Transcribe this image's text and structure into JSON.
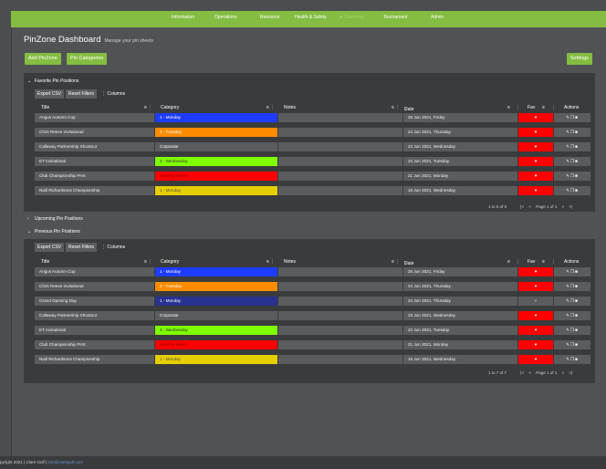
{
  "nav": {
    "items": [
      {
        "label": "Information",
        "icon": "",
        "dim": false
      },
      {
        "label": "Operations",
        "icon": "",
        "dim": false
      },
      {
        "label": "Resource",
        "icon": "",
        "dim": false
      },
      {
        "label": "Health & Safety",
        "icon": "",
        "dim": false
      },
      {
        "label": "Coaching",
        "icon": "lock-icon",
        "dim": true
      },
      {
        "label": "Tournament",
        "icon": "",
        "dim": false
      },
      {
        "label": "Admin",
        "icon": "",
        "dim": false
      }
    ]
  },
  "page": {
    "title": "PinZone Dashboard",
    "subtitle": "Manage your pin sheets"
  },
  "buttons": {
    "add": "Add PinZone",
    "categories": "Pin Categories",
    "settings": "Settings"
  },
  "sections": {
    "favorite": "Favorite Pin Positions",
    "upcoming": "Upcoming Pin Positions",
    "previous": "Previous Pin Positions"
  },
  "toolbar": {
    "export": "Export CSV",
    "reset": "Reset Filters",
    "columns": "Columns"
  },
  "columns": {
    "title": "Title",
    "category": "Category",
    "notes": "Notes",
    "date": "Date",
    "fav": "Fav",
    "actions": "Actions"
  },
  "colors": {
    "accent": "#84bd42",
    "fav": "#ff0000"
  },
  "favorite_rows": [
    {
      "title": "Angus Autumn Cup",
      "category": "1 - Monday",
      "cat_color": "#1e3cff",
      "cat_text": "#ffffff",
      "date": "25 Jun 2021, Friday",
      "fav": true
    },
    {
      "title": "Chris Reeve Invitational",
      "category": "2 - Tuesday",
      "cat_color": "#ff8c00",
      "cat_text": "#ffffff",
      "date": "24 Jun 2021, Thursday",
      "fav": true
    },
    {
      "title": "Callaway Partnership Shootout",
      "category": "Corporate",
      "cat_color": "#5a5c5e",
      "cat_text": "#ffffff",
      "date": "23 Jun 2021, Wednesday",
      "fav": true
    },
    {
      "title": "ET Invitational",
      "category": "3 - Wednesday",
      "cat_color": "#7fff00",
      "cat_text": "#333333",
      "date": "22 Jun 2021, Tuesday",
      "fav": true
    },
    {
      "title": "Club Championship PHX",
      "category": "Monthly Medal",
      "cat_color": "#ff0000",
      "cat_text": "#8b0000",
      "date": "21 Jun 2021, Monday",
      "fav": true
    },
    {
      "title": "Niall Richardsons Championship",
      "category": "1 - Monday",
      "cat_color": "#e6cf00",
      "cat_text": "#555555",
      "date": "16 Jun 2021, Wednesday",
      "fav": true
    }
  ],
  "previous_rows": [
    {
      "title": "Angus Autumn Cup",
      "category": "1 - Monday",
      "cat_color": "#1e3cff",
      "cat_text": "#ffffff",
      "date": "25 Jun 2021, Friday",
      "fav": true
    },
    {
      "title": "Chris Reeve Invitational",
      "category": "2 - Tuesday",
      "cat_color": "#ff8c00",
      "cat_text": "#ffffff",
      "date": "24 Jun 2021, Thursday",
      "fav": true
    },
    {
      "title": "Grand Opening Day",
      "category": "1 - Monday",
      "cat_color": "#283290",
      "cat_text": "#ffffff",
      "date": "24 Jun 2021, Thursday",
      "fav": false
    },
    {
      "title": "Callaway Partnership Shootout",
      "category": "Corporate",
      "cat_color": "#5a5c5e",
      "cat_text": "#ffffff",
      "date": "23 Jun 2021, Wednesday",
      "fav": true
    },
    {
      "title": "ET Invitational",
      "category": "3 - Wednesday",
      "cat_color": "#7fff00",
      "cat_text": "#333333",
      "date": "22 Jun 2021, Tuesday",
      "fav": true
    },
    {
      "title": "Club Championship PHX",
      "category": "Monthly Medal",
      "cat_color": "#ff0000",
      "cat_text": "#8b0000",
      "date": "21 Jun 2021, Monday",
      "fav": true
    },
    {
      "title": "Niall Richardsons Championship",
      "category": "1 - Monday",
      "cat_color": "#e6cf00",
      "cat_text": "#555555",
      "date": "16 Jun 2021, Wednesday",
      "fav": true
    }
  ],
  "pager": {
    "favorite_count": "1 to 6 of 6",
    "previous_count": "1 to 7 of 7",
    "page_label": "Page 1 of 1"
  },
  "footer": {
    "text": "pyright 2021  |  Clare Golf  |",
    "link": "info@claregolf.com"
  }
}
